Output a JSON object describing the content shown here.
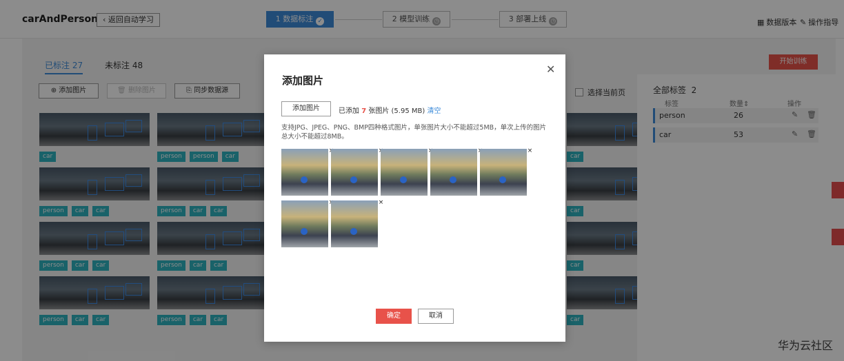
{
  "app": {
    "title": "carAndPerson",
    "back_label": "返回自动学习"
  },
  "steps": [
    {
      "label": "1 数据标注",
      "state": "active",
      "icon": "check-icon"
    },
    {
      "label": "2 模型训练",
      "state": "pending",
      "icon": "clock-icon"
    },
    {
      "label": "3 部署上线",
      "state": "pending",
      "icon": "clock-icon"
    }
  ],
  "header_links": {
    "data_version": "数据版本",
    "guide": "操作指导"
  },
  "tabs": {
    "labeled": "已标注 27",
    "unlabeled": "未标注 48"
  },
  "toolbar": {
    "add_images": "添加图片",
    "delete_images": "删除图片",
    "sync_source": "同步数据源",
    "select_page": "选择当前页",
    "start_training": "开始训练"
  },
  "gallery": {
    "columns": [
      [
        [
          "car"
        ],
        [
          "person",
          "car",
          "car"
        ],
        [
          "person",
          "car",
          "car"
        ],
        [
          "person",
          "car",
          "car"
        ]
      ],
      [
        [
          "person",
          "person",
          "car"
        ],
        [
          "person",
          "car",
          "car"
        ],
        [
          "person",
          "car",
          "car"
        ],
        [
          "person",
          "car",
          "car"
        ]
      ],
      [
        [
          "car"
        ],
        [
          "car"
        ],
        [
          "car"
        ],
        [
          "car"
        ]
      ]
    ]
  },
  "label_panel": {
    "title": "全部标签",
    "total": "2",
    "col_label": "标签",
    "col_count": "数量",
    "col_action": "操作",
    "rows": [
      {
        "name": "person",
        "count": "26"
      },
      {
        "name": "car",
        "count": "53"
      }
    ]
  },
  "modal": {
    "title": "添加图片",
    "add_button": "添加图片",
    "added_prefix": "已添加",
    "added_count": "7",
    "added_suffix": "张图片 (5.95 MB)",
    "clear": "清空",
    "hint": "支持JPG、JPEG、PNG、BMP四种格式图片，单张图片大小不能超过5MB，单次上传的图片总大小不能超过8MB。",
    "image_count": 7,
    "ok": "确定",
    "cancel": "取消"
  },
  "watermark": "华为云社区",
  "colors": {
    "accent": "#3d8bd9",
    "danger": "#e8524a",
    "tag": "#2fb3c0"
  }
}
